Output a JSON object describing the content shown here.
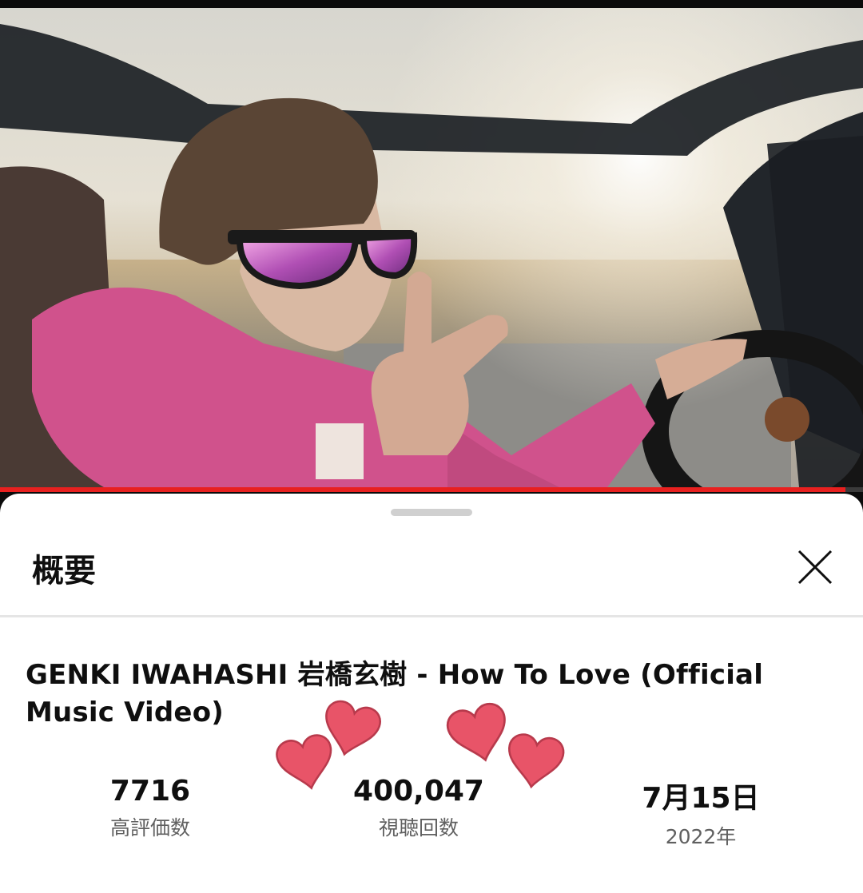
{
  "sheet": {
    "title": "概要",
    "close_icon": "close-icon"
  },
  "video": {
    "title": "GENKI IWAHASHI 岩橋玄樹 - How To Love (Official Music Video)",
    "progress": 0.98,
    "progress_color": "#e8201f"
  },
  "stats": {
    "likes_value": "7716",
    "likes_label": "高評価数",
    "views_value": "400,047",
    "views_label": "視聴回数",
    "date_value": "7月15日",
    "date_label": "2022年"
  },
  "stickers": {
    "icon": "heart-icon",
    "color": "#e85468"
  }
}
